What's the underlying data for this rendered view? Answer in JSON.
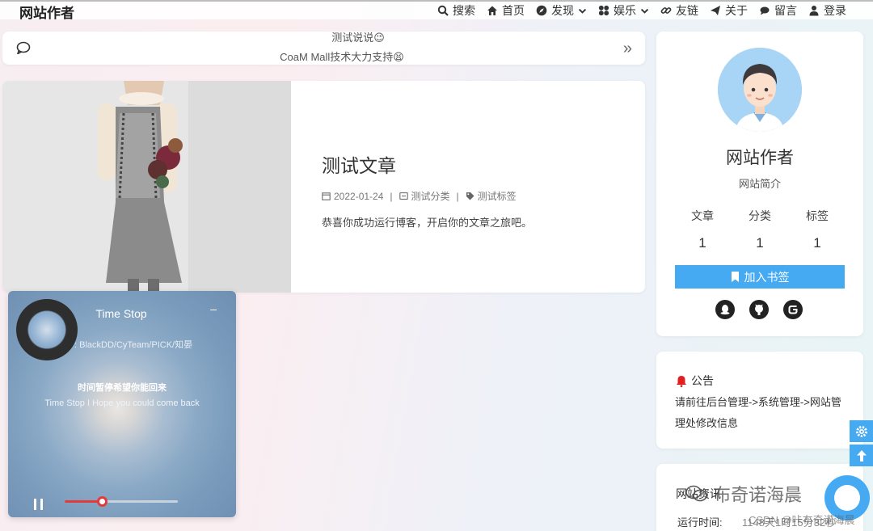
{
  "header": {
    "site_title": "网站作者",
    "nav": [
      {
        "icon": "search-icon",
        "label": "搜索"
      },
      {
        "icon": "home-icon",
        "label": "首页"
      },
      {
        "icon": "compass-icon",
        "label": "发现",
        "dropdown": true
      },
      {
        "icon": "grid-icon",
        "label": "娱乐",
        "dropdown": true
      },
      {
        "icon": "link-icon",
        "label": "友链"
      },
      {
        "icon": "send-icon",
        "label": "关于"
      },
      {
        "icon": "comment-icon",
        "label": "留言"
      },
      {
        "icon": "user-icon",
        "label": "登录"
      }
    ]
  },
  "ticker": {
    "line1": "测试说说",
    "line1_emoji": "😉",
    "line2": "CoaM Mall技术大力支持",
    "line2_emoji": "😫",
    "next": "»"
  },
  "post": {
    "title": "测试文章",
    "date": "2022-01-24",
    "category": "测试分类",
    "tag": "测试标签",
    "excerpt": "恭喜你成功运行博客，开启你的文章之旅吧。"
  },
  "player": {
    "song_title": "Time Stop",
    "minimize": "–",
    "artist": ": BlackDD/CyTeam/PICK/知晏",
    "lyric_cn": "时间暂停希望你能回来",
    "lyric_en": "Time Stop I Hope you could come back",
    "progress": 0.33
  },
  "profile": {
    "name": "网站作者",
    "bio": "网站简介",
    "stats": [
      {
        "label": "文章",
        "value": "1"
      },
      {
        "label": "分类",
        "value": "1"
      },
      {
        "label": "标签",
        "value": "1"
      }
    ],
    "bookmark_label": "加入书签"
  },
  "notice": {
    "title": "公告",
    "text": "请前往后台管理->系统管理->网站管理处修改信息"
  },
  "site_info": {
    "title": "网站资讯",
    "runtime_label": "运行时间:",
    "runtime_value": "1148天1时15分32秒"
  },
  "watermark": {
    "text": "布奇诺海晨",
    "small": "CSDN @咔布奇诺海晨"
  },
  "colors": {
    "accent": "#45aaf2",
    "progress": "#e23b3b",
    "bell": "#e02020"
  }
}
